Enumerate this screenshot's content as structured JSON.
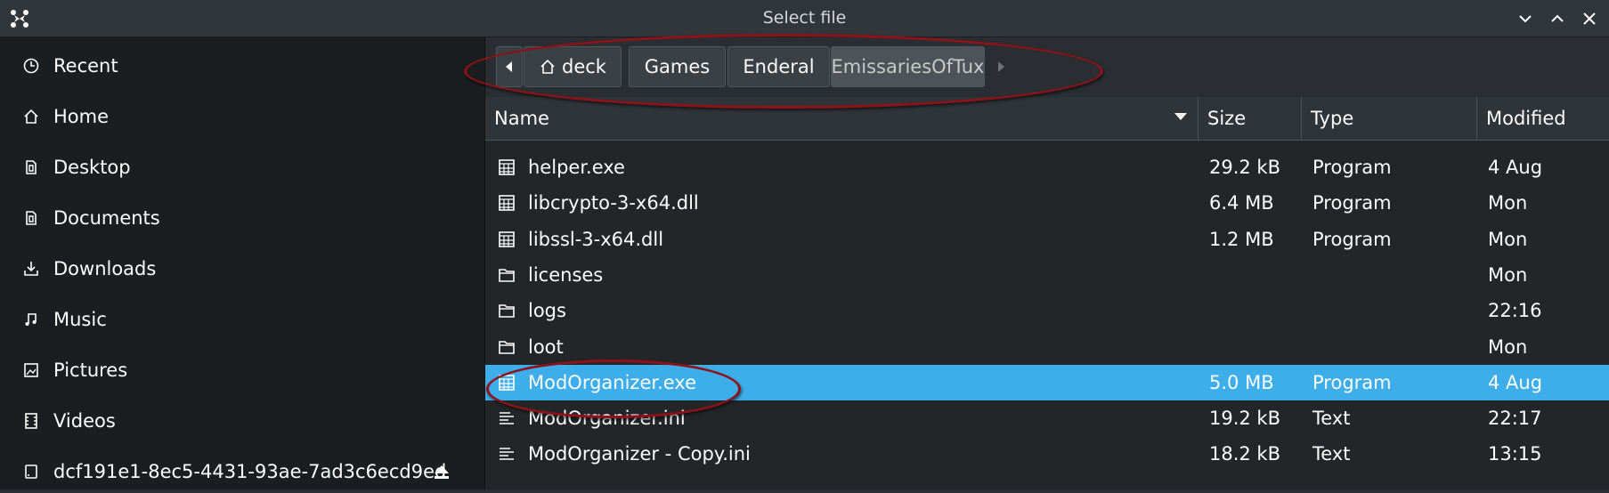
{
  "window": {
    "title": "Select file"
  },
  "sidebar": {
    "items": [
      {
        "label": "Recent",
        "icon": "clock-icon"
      },
      {
        "label": "Home",
        "icon": "home-icon"
      },
      {
        "label": "Desktop",
        "icon": "desktop-icon"
      },
      {
        "label": "Documents",
        "icon": "documents-icon"
      },
      {
        "label": "Downloads",
        "icon": "download-icon"
      },
      {
        "label": "Music",
        "icon": "music-icon"
      },
      {
        "label": "Pictures",
        "icon": "pictures-icon"
      },
      {
        "label": "Videos",
        "icon": "videos-icon"
      },
      {
        "label": "dcf191e1-8ec5-4431-93ae-7ad3c6ecd9ed",
        "icon": "drive-icon"
      }
    ]
  },
  "breadcrumb": {
    "items": [
      "deck",
      "Games",
      "Enderal",
      "EmissariesOfTux"
    ]
  },
  "columns": {
    "name": "Name",
    "size": "Size",
    "type": "Type",
    "modified": "Modified"
  },
  "files": [
    {
      "name": "helper.exe",
      "size": "29.2 kB",
      "type": "Program",
      "modified": "4 Aug",
      "kind": "program"
    },
    {
      "name": "libcrypto-3-x64.dll",
      "size": "6.4 MB",
      "type": "Program",
      "modified": "Mon",
      "kind": "program"
    },
    {
      "name": "libssl-3-x64.dll",
      "size": "1.2 MB",
      "type": "Program",
      "modified": "Mon",
      "kind": "program"
    },
    {
      "name": "licenses",
      "size": "",
      "type": "",
      "modified": "Mon",
      "kind": "folder"
    },
    {
      "name": "logs",
      "size": "",
      "type": "",
      "modified": "22:16",
      "kind": "folder"
    },
    {
      "name": "loot",
      "size": "",
      "type": "",
      "modified": "Mon",
      "kind": "folder"
    },
    {
      "name": "ModOrganizer.exe",
      "size": "5.0 MB",
      "type": "Program",
      "modified": "4 Aug",
      "kind": "program",
      "selected": true
    },
    {
      "name": "ModOrganizer.ini",
      "size": "19.2 kB",
      "type": "Text",
      "modified": "22:17",
      "kind": "text"
    },
    {
      "name": "ModOrganizer - Copy.ini",
      "size": "18.2 kB",
      "type": "Text",
      "modified": "13:15",
      "kind": "text"
    }
  ],
  "colors": {
    "selection": "#3daee9",
    "annotation": "#8e1217"
  }
}
